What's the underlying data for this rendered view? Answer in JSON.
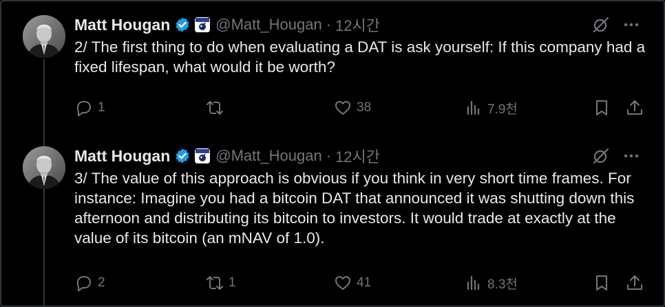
{
  "tweets": [
    {
      "author": {
        "name": "Matt Hougan",
        "handle": "@Matt_Hougan",
        "time": "12시간"
      },
      "text": "2/ The first thing to do when evaluating a DAT is ask yourself: If this company had a fixed lifespan, what would it be worth?",
      "replies": "1",
      "reposts": "",
      "likes": "38",
      "views": "7.9천"
    },
    {
      "author": {
        "name": "Matt Hougan",
        "handle": "@Matt_Hougan",
        "time": "12시간"
      },
      "text": "3/ The value of this approach is obvious if you think in very short time frames. For instance: Imagine you had a bitcoin DAT that announced it was shutting down this afternoon and distributing its bitcoin to investors. It would trade at exactly at the value of its bitcoin (an mNAV of 1.0).",
      "replies": "2",
      "reposts": "1",
      "likes": "41",
      "views": "8.3천"
    }
  ],
  "separator": "·",
  "colors": {
    "background": "#000000",
    "text": "#e7e9ea",
    "muted": "#71767b",
    "verified": "#1d9bf0"
  },
  "icons": [
    "verified-badge-icon",
    "affiliate-badge-icon",
    "grok-icon",
    "more-icon",
    "reply-icon",
    "repost-icon",
    "like-icon",
    "views-icon",
    "bookmark-icon",
    "share-icon"
  ]
}
